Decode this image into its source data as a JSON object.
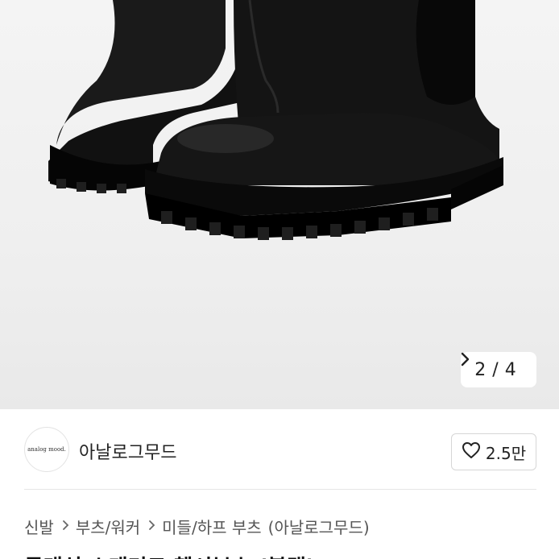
{
  "gallery": {
    "image_alt": "black chelsea boots",
    "counter_current": "2",
    "counter_sep": "/",
    "counter_total": "4"
  },
  "seller": {
    "avatar_text": "analog mood.",
    "name": "아날로그무드",
    "like_count": "2.5만"
  },
  "breadcrumb": {
    "items": [
      "신발",
      "부츠/워커",
      "미들/하프 부츠",
      "(아날로그무드)"
    ]
  },
  "product": {
    "title_partial": "클래식 스태커드 첼시부츠 (블랙)"
  },
  "colors": {
    "background": "#ffffff",
    "hero_bg": "#efefef",
    "boot": "#0d0d0d"
  }
}
